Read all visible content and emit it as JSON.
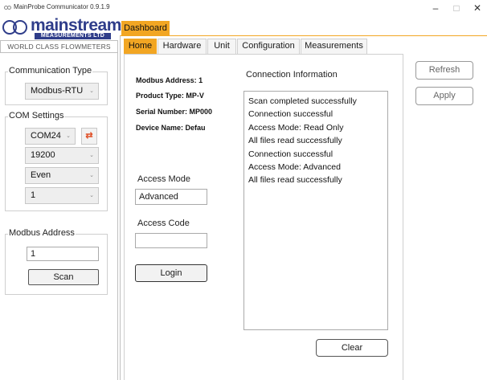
{
  "window": {
    "title": "MainProbe Communicator 0.9.1.9",
    "minimize_glyph": "–",
    "maximize_glyph": "□",
    "close_glyph": "✕"
  },
  "logo": {
    "name": "mainstream",
    "trademark": "™",
    "subtitle": "MEASUREMENTS LTD",
    "tagline": "WORLD CLASS FLOWMETERS",
    "brand_color": "#2f3d8a"
  },
  "left_panel": {
    "communication_type": {
      "label": "Communication Type",
      "value": "Modbus-RTU"
    },
    "com_settings": {
      "label": "COM Settings",
      "port": "COM24",
      "refresh_icon": "refresh-icon",
      "baud_rate": "19200",
      "parity": "Even",
      "stop_bits": "1"
    },
    "modbus_address": {
      "label": "Modbus Address",
      "value": "1",
      "scan_label": "Scan"
    }
  },
  "dashboard_tab": {
    "label": "Dashboard",
    "accent": "#f2a623"
  },
  "tabs": [
    {
      "label": "Home",
      "active": true
    },
    {
      "label": "Hardware",
      "active": false
    },
    {
      "label": "Unit",
      "active": false
    },
    {
      "label": "Configuration",
      "active": false
    },
    {
      "label": "Measurements",
      "active": false
    }
  ],
  "home": {
    "device_info": {
      "modbus_address": "Modbus Address: 1",
      "product_type": "Product Type: MP-V",
      "serial_number": "Serial Number: MP000",
      "device_name": "Device Name: Defau"
    },
    "access_mode": {
      "label": "Access Mode",
      "value": "Advanced"
    },
    "access_code": {
      "label": "Access Code",
      "value": ""
    },
    "login_label": "Login",
    "connection_info": {
      "title": "Connection Information",
      "log": [
        "Scan completed successfully",
        "Connection successful",
        "Access Mode:  Read Only",
        "All files read successfully",
        "Connection successful",
        "Access Mode:  Advanced",
        "All files read successfully"
      ]
    },
    "clear_label": "Clear"
  },
  "side_buttons": {
    "refresh_label": "Refresh",
    "apply_label": "Apply"
  }
}
